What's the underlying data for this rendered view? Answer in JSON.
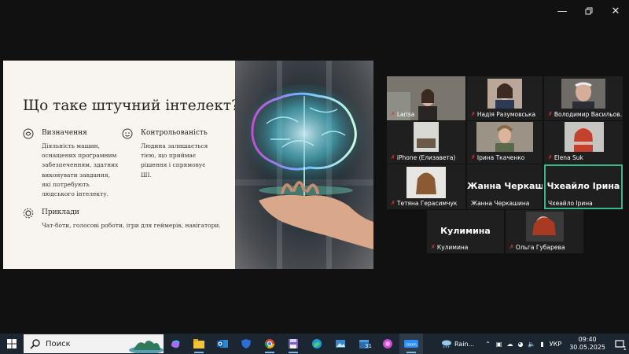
{
  "window": {
    "controls": [
      "minimize-icon",
      "restore-icon",
      "close-icon"
    ]
  },
  "slide": {
    "title": "Що таке штучний інтелект?",
    "features": [
      {
        "icon": "brain-icon",
        "title": "Визначення",
        "text": "Діяльність машин, оснащених програмним забезпеченням, здатних виконувати завдання, які потребують людського інтелекту."
      },
      {
        "icon": "face-icon",
        "title": "Контрольованість",
        "text": "Людина залишається тією, що приймає рішення і спрямовує ШІ."
      },
      {
        "icon": "gear-icon",
        "title": "Приклади",
        "text": "Чат-боти, голосові роботи, ігри для геймерів, навігатори."
      }
    ]
  },
  "participants": [
    {
      "name": "Larisa",
      "video": true,
      "muted": true
    },
    {
      "name": "Надія Разумовська",
      "video": true,
      "muted": true
    },
    {
      "name": "Володимир Васильов...",
      "video": true,
      "muted": true
    },
    {
      "name": "iPhone (Елизавета)",
      "video": true,
      "muted": true
    },
    {
      "name": "Ірина Ткаченко",
      "video": true,
      "muted": true
    },
    {
      "name": "Elena Suk",
      "video": true,
      "muted": true
    },
    {
      "name": "Тетяна Герасимчук",
      "video": true,
      "muted": true
    },
    {
      "name": "Жанна Черкашина",
      "display": "Жанна Черкаш...",
      "video": false,
      "muted": false
    },
    {
      "name": "Чхеайло Ірина",
      "display": "Чхеайло Ірина",
      "video": false,
      "muted": false,
      "active": true
    },
    {
      "name": "Кулимина",
      "display": "Кулимина",
      "video": false,
      "muted": true
    },
    {
      "name": "Ольга Губарева",
      "video": true,
      "muted": true
    }
  ],
  "taskbar": {
    "search_placeholder": "Поиск",
    "weather": "Rain...",
    "language": "УКР",
    "time": "09:40",
    "date": "30.05.2025",
    "notifications": "1",
    "apps": [
      "copilot-icon",
      "file-explorer-icon",
      "outlook-icon",
      "defender-icon",
      "chrome-icon",
      "save-icon",
      "edge-icon",
      "photos-icon",
      "calendar-icon",
      "teams-icon",
      "zoom-icon"
    ],
    "calendar_badge": "31"
  },
  "colors": {
    "active_speaker": "#3ab88c",
    "muted_mic": "#e5343b",
    "taskbar": "#1c2630"
  }
}
